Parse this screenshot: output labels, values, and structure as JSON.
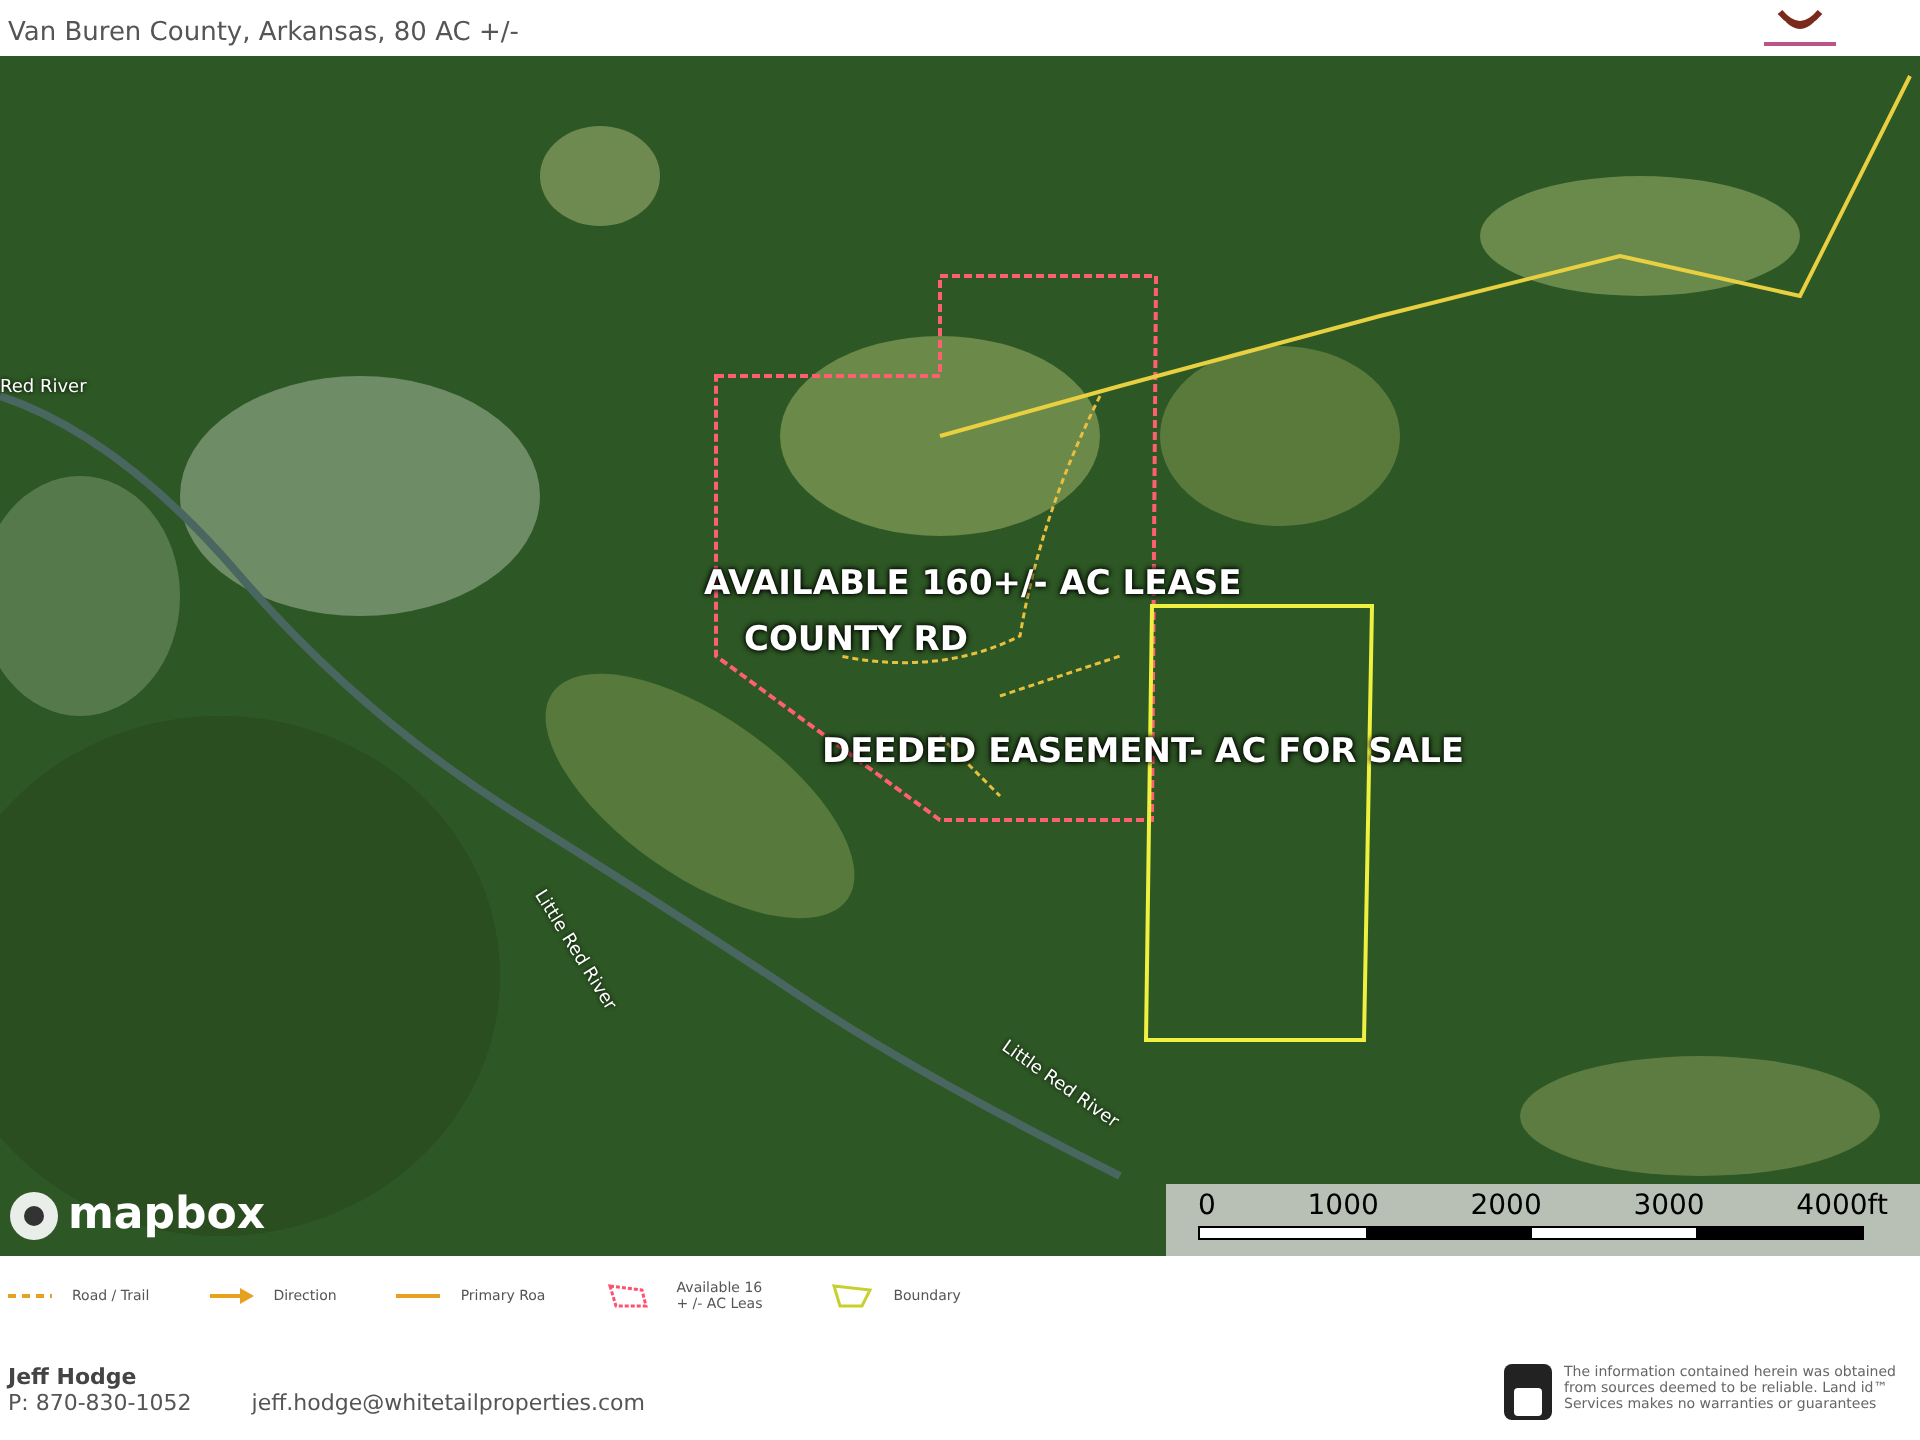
{
  "header": {
    "subtitle": "Van Buren County, Arkansas, 80 AC +/-"
  },
  "map": {
    "labels": [
      {
        "kind": "overlay",
        "text": "AVAILABLE 160+/- AC LEASE"
      },
      {
        "kind": "overlay",
        "text": "COUNTY RD"
      },
      {
        "kind": "overlay",
        "text": "DEEDED EASEMENT- AC FOR SALE"
      },
      {
        "kind": "river",
        "text": "Red River"
      },
      {
        "kind": "river",
        "text": "Little Red River"
      },
      {
        "kind": "river",
        "text": "Little Red River"
      }
    ],
    "attribution": "mapbox",
    "scale": {
      "ticks": [
        "0",
        "1000",
        "2000",
        "3000",
        "4000ft"
      ]
    }
  },
  "legend": [
    {
      "kind": "dashed",
      "label": "Road / Trail"
    },
    {
      "kind": "arrow",
      "label": "Direction"
    },
    {
      "kind": "line",
      "label": "Primary Roa"
    },
    {
      "kind": "lease",
      "label": "Available 16 + /- AC Leas"
    },
    {
      "kind": "boundary",
      "label": "Boundary"
    }
  ],
  "footer": {
    "agent": "Jeff Hodge",
    "phone": "P: 870-830-1052",
    "email": "jeff.hodge@whitetailproperties.com",
    "disclaimer": "The information contained herein was obtained from sources deemed to be reliable. Land id™ Services makes no warranties or guarantees"
  }
}
